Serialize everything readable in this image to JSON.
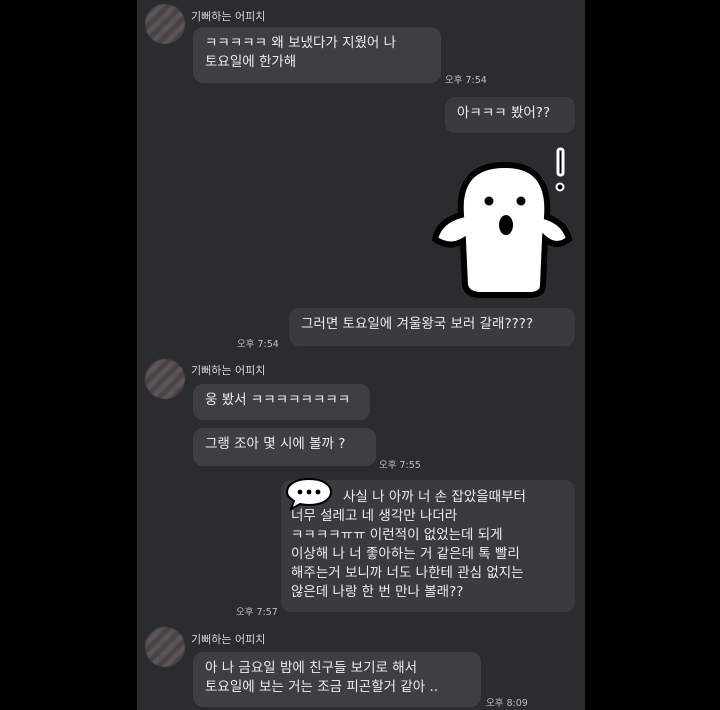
{
  "messages": {
    "sender_name": "기뻐하는 어피치",
    "m1": {
      "lines": [
        "ㅋㅋㅋㅋㅋ 왜 보냈다가 지웠어 나",
        "토요일에 한가해"
      ],
      "time": "오후 7:54"
    },
    "m2": {
      "text": "아ㅋㅋㅋ 봤어??"
    },
    "m3": {
      "text": "그러면 토요일에 겨울왕국 보러 갈래????",
      "time": "오후 7:54"
    },
    "m4": {
      "text": "웅 봤서 ㅋㅋㅋㅋㅋㅋㅋㅋ"
    },
    "m5": {
      "text": "그랭 조아 몇 시에 볼까 ?",
      "time": "오후 7:55"
    },
    "m6": {
      "lines": [
        "사실 나 아까 너 손 잡았을때부터",
        "너무 설레고 네 생각만 나더라",
        "ㅋㅋㅋㅋㅠㅠ 이런적이 없었는데 되게",
        "이상해 나 너 좋아하는 거 같은데 톡 빨리",
        "해주는거 보니까 너도 나한테 관심 없지는",
        "않은데 나랑 한 번 만나 볼래??"
      ],
      "time": "오후 7:57"
    },
    "m7": {
      "lines": [
        "아 나 금요일 밤에 친구들 보기로 해서",
        "토요일에 보는 거는 조금 피곤할거 같아 .."
      ],
      "time": "오후 8:09"
    }
  },
  "icons": {
    "sticker": "surprised-ghost-sticker",
    "speech": "speech-bubble-dots-icon"
  },
  "colors": {
    "background": "#000000",
    "chat_bg": "#2b2c30",
    "bubble": "#3e3f45",
    "text": "#ececec"
  }
}
